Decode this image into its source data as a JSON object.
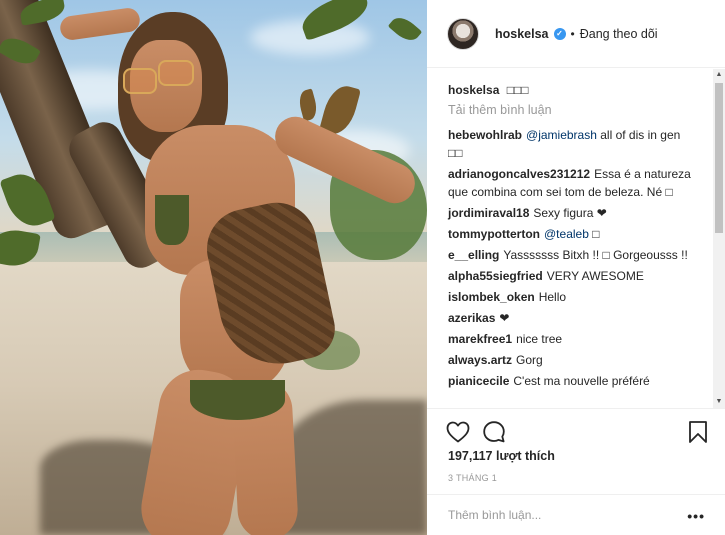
{
  "post": {
    "image_alt": "Photo by hoskelsa"
  },
  "header": {
    "username": "hoskelsa",
    "separator": "•",
    "follow_state": "Đang theo dõi"
  },
  "caption": {
    "username": "hoskelsa",
    "text": "□□□"
  },
  "load_more": "Tải thêm bình luận",
  "comments": [
    {
      "user": "hebewohlrab",
      "mention": "@jamiebrash",
      "text": "all of dis in gen □□"
    },
    {
      "user": "adrianogoncalves231212",
      "mention": "",
      "text": "Essa é a natureza que combina com sei tom de beleza. Né □"
    },
    {
      "user": "jordimiraval18",
      "mention": "",
      "text": "Sexy figura ❤"
    },
    {
      "user": "tommypotterton",
      "mention": "@tealeb",
      "text": "□"
    },
    {
      "user": "e__elling",
      "mention": "",
      "text": "Yasssssss Bitxh !! □ Gorgeousss !!"
    },
    {
      "user": "alpha55siegfried",
      "mention": "",
      "text": "VERY AWESOME"
    },
    {
      "user": "islombek_oken",
      "mention": "",
      "text": "Hello"
    },
    {
      "user": "azerikas",
      "mention": "",
      "text": "❤"
    },
    {
      "user": "marekfree1",
      "mention": "",
      "text": "nice tree"
    },
    {
      "user": "always.artz",
      "mention": "",
      "text": "Gorg"
    },
    {
      "user": "pianicecile",
      "mention": "",
      "text": "C'est ma nouvelle préféré"
    }
  ],
  "actions": {
    "like_icon": "heart-icon",
    "comment_icon": "comment-icon",
    "save_icon": "bookmark-icon"
  },
  "likes": "197,117 lượt thích",
  "timestamp": "3 THÁNG 1",
  "add_comment": {
    "placeholder": "Thêm bình luận...",
    "more": "•••"
  },
  "colors": {
    "link": "#003569",
    "verified": "#3897f0",
    "muted": "#999999",
    "text": "#262626"
  }
}
